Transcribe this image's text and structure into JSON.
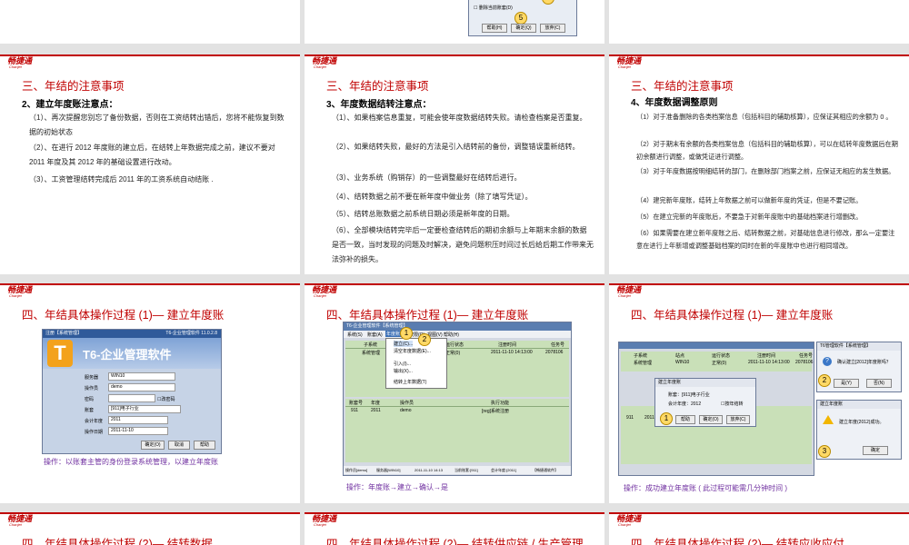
{
  "brand": {
    "logo": "畅捷通",
    "sub": "Chanjet"
  },
  "row0": {
    "dialog_checkbox": "删除当前账套(D)",
    "dialog_buttons": [
      "帮助(H)",
      "确定(Q)",
      "放弃(C)"
    ],
    "badges": [
      "4",
      "5"
    ]
  },
  "p1": {
    "title": "三、年结的注意事项",
    "subtitle": "2、建立年度账注意点：",
    "items": [
      "（1）、再次提醒您别忘了备份数据，否则在工资结转出错后，您将不能恢复到数据的初始状态",
      "（2）、在进行 2012 年度账的建立后，在结转上年数据完成之前，建议不要对 2011 年度及其 2012 年的基础设置进行改动。",
      "（3）、工资管理结转完成后 2011 年的工资系统自动结账 ."
    ]
  },
  "p2": {
    "title": "三、年结的注意事项",
    "subtitle": "3、年度数据结转注意点：",
    "items": [
      "（1）、如果档案信息重复，可能会使年度数据结转失败。请检查档案是否重复。",
      "（2）、如果结转失败，最好的方法是引入结转前的备份，调整错误重新结转。",
      "（3）、业务系统（购销存）的一些调整最好在结转后进行。",
      "（4）、结转数据之前不要在新年度中做业务（除了填写凭证）。",
      "（5）、结转总账数据之前系统日期必须是新年度的日期。",
      "（6）、全部模块结转完毕后一定要检查结转后的期初余额与上年期末余额的数据是否一致，当时发现的问题及时解决，避免问题积压时间过长后给后期工作带来无法弥补的损失。"
    ]
  },
  "p3": {
    "title": "三、年结的注意事项",
    "subtitle": "4、年度数据调整原则",
    "items": [
      "（1）对于准备删除的各类档案信息（包括科目的辅助核算），应保证其相应的余额为 0 。",
      "（2）对于期末有余额的各类档案信息（包括科目的辅助核算），可以在结转年度数据后在期初余额进行调整，或做凭证进行调整。",
      "（3）对于年度数据按明细结转的部门，在删除部门档案之前，应保证无相应的发生数据。",
      "（4）建完新年度账，结转上年数据之前可以做新年度的凭证，但是不要记账。",
      "（5）在建立完新的年度账后，不要急于对新年度账中的基础档案进行增删改。",
      "（6）如果需要在建立新年度账之后、结转数据之前，对基础信息进行修改，那么一定要注意在进行上年新增或调整基础档案的同时在新的年度账中也进行相同增改。"
    ]
  },
  "p4": {
    "title": "四、年结具体操作过程 (1)— 建立年度账",
    "caption": "操作：以账套主管的身份登录系统管理，以建立年度账",
    "login": {
      "window_title": "注册【系统管理】",
      "version": "T6-企业管理软件 11.0.2.8",
      "product": "T6-企业管理软件",
      "fields": [
        {
          "label": "服务器",
          "value": "WIN10"
        },
        {
          "label": "操作员",
          "value": "demo"
        },
        {
          "label": "密码",
          "value": ""
        },
        {
          "label": "账套",
          "value": "[911]电子行业"
        },
        {
          "label": "会计年度",
          "value": "2011"
        },
        {
          "label": "操作日期",
          "value": "2011-11-10"
        }
      ],
      "change_pwd": "改密码",
      "buttons": [
        "确定(O)",
        "取消",
        "帮助"
      ]
    }
  },
  "p5": {
    "title": "四、年结具体操作过程 (1)— 建立年度账",
    "caption": "操作：年度账→建立→确认→是",
    "app_title": "T6-企业管理软件【系统管理】",
    "menu": [
      "系统(S)",
      "账套(A)",
      "年度账(Y)",
      "权限(O)",
      "视图(V)",
      "帮助(H)"
    ],
    "dropdown": [
      "建立(C)...",
      "清空年度数据(E)...",
      "引入(I)...",
      "输出(X)...",
      "结转上年数据(T)"
    ],
    "table_head": [
      "子系统",
      "站点",
      "运行状态",
      "注册时间",
      "任务号"
    ],
    "table_row": [
      "系统管理",
      "WIN10",
      "正常(0)",
      "2011-11-10 14:13:00",
      "2078106"
    ],
    "bottom_head": [
      "账套号",
      "年度",
      "操作员",
      "执行功能"
    ],
    "bottom_row": [
      "911",
      "2011",
      "demo",
      "[reg]系统注册"
    ],
    "status": [
      "操作员[demo]",
      "服务器[WIN10]",
      "2011-11-10 14:13",
      "当前账套:[911]",
      "会计年度:[2011]",
      "【畅捷通软件】"
    ],
    "badges": [
      "1",
      "2"
    ]
  },
  "p6": {
    "title": "四、年结具体操作过程 (1)— 建立年度账",
    "caption": "操作：成功建立年度账 ( 此过程可能需几分钟时间 )",
    "table_head": [
      "子系统",
      "站点",
      "运行状态",
      "注册时间",
      "任务号"
    ],
    "table_row": [
      "系统管理",
      "WIN10",
      "正常(0)",
      "2011-11-10 14:13:00",
      "2078106"
    ],
    "dialog_title": "建立年度账",
    "dialog_fields": [
      "账套：[911]电子行业",
      "会计年度：2012"
    ],
    "dialog_check": "按年结转",
    "dialog_buttons": [
      "帮助",
      "确定(O)",
      "放弃(C)"
    ],
    "confirm_title": "T6管理软件【系统管理】",
    "confirm_text": "确认建立[2012]年度账吗？",
    "confirm_buttons": [
      "是(Y)",
      "否(N)"
    ],
    "done_title": "建立年度账",
    "done_text": "建立年度(2012)成功。",
    "done_button": "确定",
    "bottom_row": [
      "911",
      "2011"
    ],
    "badges": [
      "1",
      "2",
      "3"
    ]
  },
  "row3": {
    "titles": [
      "四、年结具体操作过程 (2)— 结转数据",
      "四、年结具体操作过程 (2)— 结转供应链 / 生产管理",
      "四、年结具体操作过程 (2)— 结转应收应付"
    ]
  }
}
